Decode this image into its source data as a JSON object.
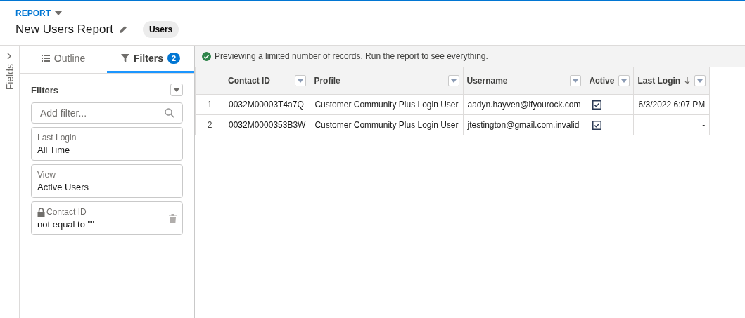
{
  "header": {
    "eyebrow": "REPORT",
    "title": "New Users Report",
    "report_type": "Users"
  },
  "fields_rail": {
    "label": "Fields"
  },
  "tabs": [
    {
      "label": "Outline",
      "kind": "outline",
      "selected": false
    },
    {
      "label": "Filters",
      "kind": "filters",
      "selected": true,
      "badge": "2"
    }
  ],
  "filters_panel": {
    "heading": "Filters",
    "search": {
      "placeholder": "Add filter..."
    },
    "filters": [
      {
        "label": "Last Login",
        "value": "All Time",
        "kind": "plain"
      },
      {
        "label": "View",
        "value": "Active Users",
        "kind": "plain"
      },
      {
        "label": "Contact ID",
        "value": "not equal to \"\"",
        "kind": "locked"
      }
    ]
  },
  "notice": "Previewing a limited number of records. Run the report to see everything.",
  "table": {
    "columns": [
      {
        "label": "Contact ID",
        "sorted": false
      },
      {
        "label": "Profile",
        "sorted": false
      },
      {
        "label": "Username",
        "sorted": false
      },
      {
        "label": "Active",
        "sorted": false
      },
      {
        "label": "Last Login",
        "sorted": true
      }
    ],
    "rows": [
      {
        "number": "1",
        "contact_id": "0032M00003T4a7Q",
        "profile": "Customer Community Plus Login User",
        "username": "aadyn.hayven@ifyourock.com",
        "active": true,
        "last_login": "6/3/2022 6:07 PM"
      },
      {
        "number": "2",
        "contact_id": "0032M0000353B3W",
        "profile": "Customer Community Plus Login User",
        "username": "jtestington@gmail.com.invalid",
        "active": true,
        "last_login": "-"
      }
    ]
  }
}
